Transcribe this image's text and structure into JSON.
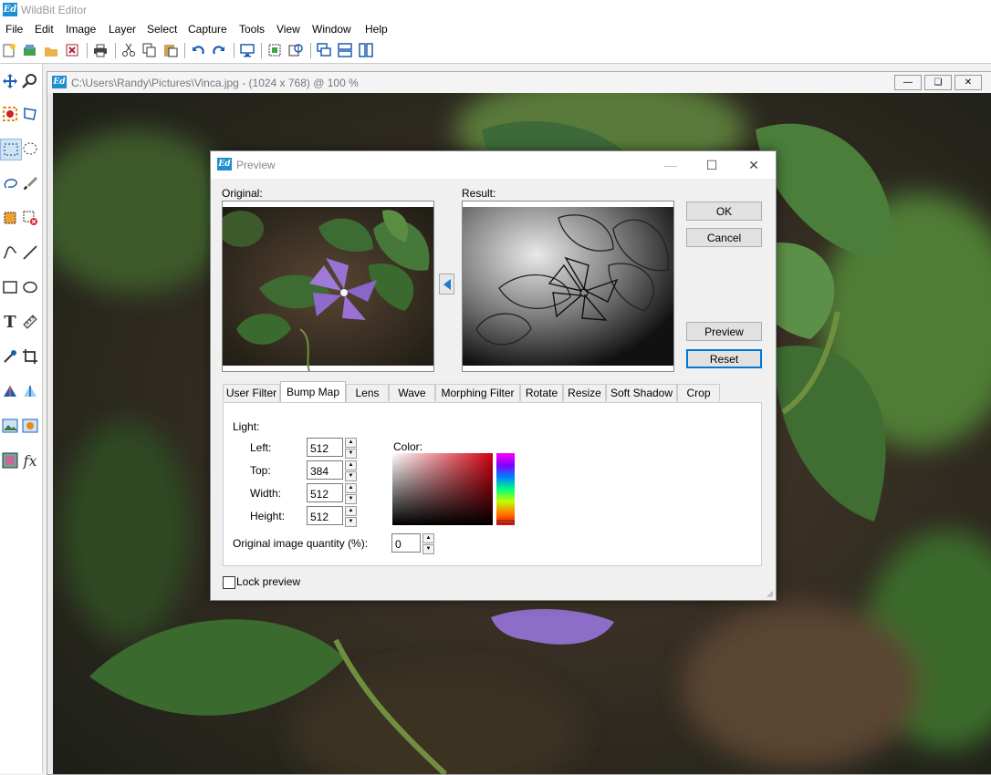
{
  "app": {
    "title": "WildBit Editor",
    "icon_text": "Ed"
  },
  "menu": [
    "File",
    "Edit",
    "Image",
    "Layer",
    "Select",
    "Capture",
    "Tools",
    "View",
    "Window",
    "Help"
  ],
  "toolbar_icons": [
    "new-icon",
    "open-icon",
    "open-folder-icon",
    "close-doc-icon",
    "print-icon",
    "cut-icon",
    "copy-icon",
    "paste-icon",
    "undo-icon",
    "redo-icon",
    "screen-icon",
    "screenshot-icon",
    "export-icon",
    "cascade-icon",
    "tile-horizontal-icon",
    "tile-vertical-icon"
  ],
  "left_tools": [
    "move-icon",
    "zoom-icon",
    "red-eye-icon",
    "transform-icon",
    "rect-select-icon",
    "ellipse-select-icon",
    "lasso-icon",
    "brush-icon",
    "crop-select-icon",
    "delete-select-icon",
    "curve-icon",
    "line-icon",
    "rectangle-icon",
    "ellipse-icon",
    "text-icon",
    "ruler-icon",
    "eyedropper-icon",
    "crop-icon",
    "shape-a-icon",
    "shape-b-icon",
    "image-adjust-icon",
    "image-effect-icon",
    "color-icon",
    "fx-icon"
  ],
  "document": {
    "path": "C:\\Users\\Randy\\Pictures\\Vinca.jpg - (1024 x 768) @ 100 %"
  },
  "dialog": {
    "title": "Preview",
    "original_label": "Original:",
    "result_label": "Result:",
    "buttons": {
      "ok": "OK",
      "cancel": "Cancel",
      "preview": "Preview",
      "reset": "Reset"
    },
    "tabs": [
      "User Filter",
      "Bump Map",
      "Lens",
      "Wave",
      "Morphing Filter",
      "Rotate",
      "Resize",
      "Soft Shadow",
      "Crop"
    ],
    "active_tab": "Bump Map",
    "bump_map": {
      "light_label": "Light:",
      "left_label": "Left:",
      "left_value": "512",
      "top_label": "Top:",
      "top_value": "384",
      "width_label": "Width:",
      "width_value": "512",
      "height_label": "Height:",
      "height_value": "512",
      "color_label": "Color:",
      "quantity_label": "Original image quantity (%):",
      "quantity_value": "0"
    },
    "lock_preview_label": "Lock preview"
  }
}
